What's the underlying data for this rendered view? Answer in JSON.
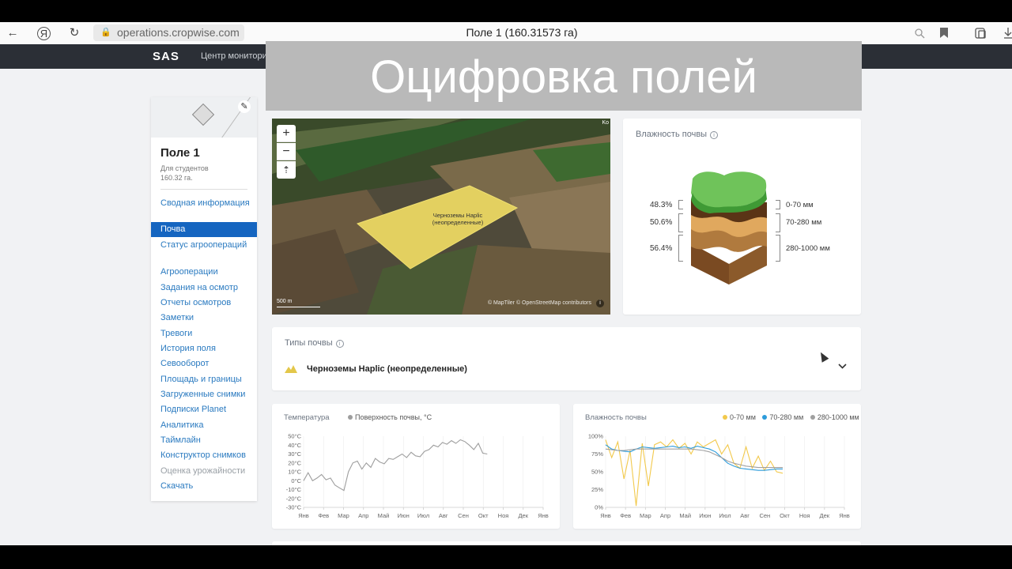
{
  "browser": {
    "url": "operations.cropwise.com",
    "tab_title": "Поле 1 (160.31573 га)",
    "back_icon": "←",
    "yandex_icon": "Я",
    "reload_icon": "↻"
  },
  "app": {
    "logo": "SAS",
    "nav_text": "Центр монитори"
  },
  "overlay_title": "Оцифровка полей",
  "field": {
    "name": "Поле 1",
    "group": "Для студентов",
    "area": "160.32 га."
  },
  "sidebar": {
    "items": [
      {
        "label": "Сводная информация"
      },
      {
        "label": "Почва"
      },
      {
        "label": "Статус агроопераций"
      },
      {
        "label": "Агрооперации"
      },
      {
        "label": "Задания на осмотр"
      },
      {
        "label": "Отчеты осмотров"
      },
      {
        "label": "Заметки"
      },
      {
        "label": "Тревоги"
      },
      {
        "label": "История поля"
      },
      {
        "label": "Севооборот"
      },
      {
        "label": "Площадь и границы"
      },
      {
        "label": "Загруженные снимки"
      },
      {
        "label": "Подписки Planet"
      },
      {
        "label": "Аналитика"
      },
      {
        "label": "Таймлайн"
      },
      {
        "label": "Конструктор снимков"
      },
      {
        "label": "Оценка урожайности"
      },
      {
        "label": "Скачать"
      }
    ],
    "active_index": 1,
    "disabled_index": 16
  },
  "map": {
    "zoom_in": "+",
    "zoom_out": "−",
    "compass": "⇡",
    "field_label_1": "Черноземы Haplic",
    "field_label_2": "(неопределенные)",
    "scale": "500 m",
    "attribution": "© MapTiler © OpenStreetMap contributors",
    "corner_text": "Ko",
    "info": "i"
  },
  "soil_moisture": {
    "title": "Влажность почвы",
    "layers": [
      {
        "percent": "48.3%",
        "depth": "0-70 мм"
      },
      {
        "percent": "50.6%",
        "depth": "70-280 мм"
      },
      {
        "percent": "56.4%",
        "depth": "280-1000 мм"
      }
    ]
  },
  "soil_types": {
    "title": "Типы почвы",
    "value": "Черноземы Haplic (неопределенные)",
    "chevron": "⌄"
  },
  "temperature_chart": {
    "title": "Температура",
    "legend": "Поверхность почвы, °C",
    "colors": {
      "line": "#9e9e9e"
    }
  },
  "moisture_chart": {
    "title": "Влажность почвы",
    "legend": [
      "0-70 мм",
      "70-280 мм",
      "280-1000 мм"
    ],
    "colors": [
      "#f2c94c",
      "#2d9cdb",
      "#a0a0a0",
      "#6fcf97"
    ]
  },
  "chart_data": [
    {
      "type": "line",
      "title": "Температура",
      "ylim": [
        -30,
        50
      ],
      "yticks": [
        "50°C",
        "40°C",
        "30°C",
        "20°C",
        "10°C",
        "0°C",
        "-10°C",
        "-20°C",
        "-30°C"
      ],
      "categories": [
        "Янв",
        "Фев",
        "Мар",
        "Апр",
        "Май",
        "Июн",
        "Июл",
        "Авг",
        "Сен",
        "Окт",
        "Ноя",
        "Дек",
        "Янв"
      ],
      "series": [
        {
          "name": "Поверхность почвы, °C",
          "values": [
            0,
            9,
            0,
            3,
            7,
            1,
            3,
            -5,
            -8,
            -11,
            10,
            20,
            22,
            13,
            20,
            15,
            25,
            21,
            19,
            25,
            24,
            27,
            30,
            26,
            32,
            28,
            27,
            33,
            35,
            40,
            38,
            43,
            41,
            45,
            42,
            46,
            44,
            40,
            35,
            42,
            31,
            30
          ]
        }
      ]
    },
    {
      "type": "line",
      "title": "Влажность почвы",
      "ylim": [
        0,
        100
      ],
      "yticks": [
        "100%",
        "75%",
        "50%",
        "25%",
        "0%"
      ],
      "categories": [
        "Янв",
        "Фев",
        "Мар",
        "Апр",
        "Май",
        "Июн",
        "Июл",
        "Авг",
        "Сен",
        "Окт",
        "Ноя",
        "Дек",
        "Янв"
      ],
      "series": [
        {
          "name": "0-70 мм",
          "values": [
            95,
            70,
            92,
            40,
            80,
            2,
            90,
            30,
            88,
            92,
            85,
            95,
            83,
            90,
            75,
            92,
            85,
            90,
            95,
            75,
            88,
            62,
            55,
            85,
            55,
            72,
            52,
            65,
            50,
            48
          ]
        },
        {
          "name": "70-280 мм",
          "values": [
            88,
            82,
            80,
            79,
            78,
            82,
            85,
            84,
            83,
            84,
            85,
            86,
            84,
            85,
            83,
            86,
            84,
            82,
            78,
            70,
            62,
            58,
            55,
            54,
            53,
            52,
            52,
            53,
            54,
            54
          ]
        },
        {
          "name": "280-1000 мм",
          "values": [
            82,
            81,
            80,
            80,
            81,
            82,
            82,
            82,
            82,
            82,
            82,
            82,
            82,
            82,
            82,
            81,
            80,
            78,
            74,
            70,
            65,
            62,
            60,
            58,
            57,
            56,
            56,
            56,
            56,
            56
          ]
        }
      ]
    }
  ]
}
